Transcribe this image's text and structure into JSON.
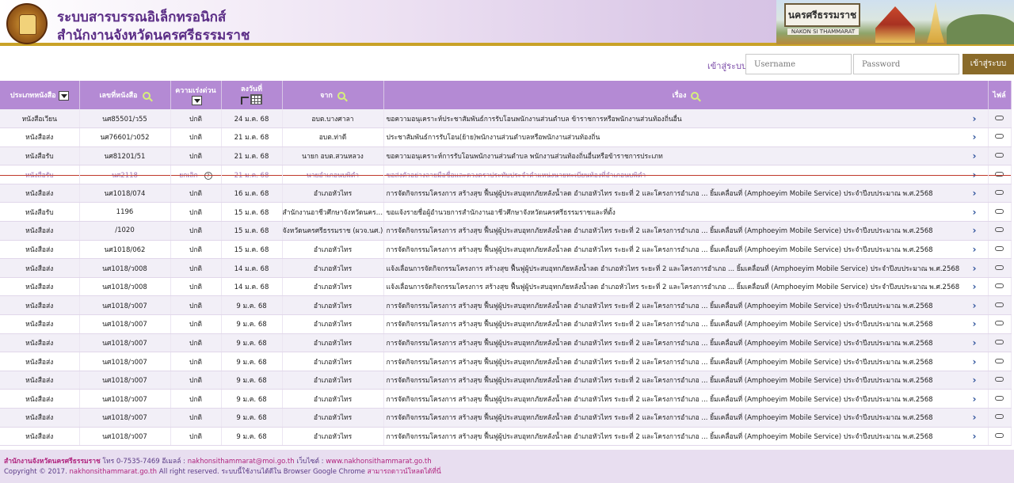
{
  "header": {
    "title_line1": "ระบบสารบรรณอิเล็กทรอนิกส์",
    "title_line2": "สำนักงานจังหวัดนครศรีธรรมราช",
    "banner_sign": "นครศรีธรรมราช",
    "banner_sign_sub": "NAKON SI THAMMARAT"
  },
  "login": {
    "label": "เข้าสู่ระบบ",
    "username_placeholder": "Username",
    "password_placeholder": "Password",
    "button": "เข้าสู่ระบบ"
  },
  "table": {
    "columns": {
      "type": "ประเภทหนังสือ",
      "number": "เลขที่หนังสือ",
      "urgency": "ความเร่งด่วน",
      "date": "ลงวันที่",
      "from": "จาก",
      "subject": "เรื่อง",
      "file": "ไฟล์"
    },
    "rows": [
      {
        "type": "หนังสือเวียน",
        "number": "นศ85501/ว55",
        "urgency": "ปกติ",
        "date": "24 ม.ค. 68",
        "from": "อบต.บางศาลา",
        "subject": "ขอความอนุเคราะห์ประชาสัมพันธ์การรับโอนพนักงานส่วนตำบล ข้าราชการหรือพนักงานส่วนท้องถิ่นอื่น"
      },
      {
        "type": "หนังสือส่ง",
        "number": "นศ76601/ว052",
        "urgency": "ปกติ",
        "date": "21 ม.ค. 68",
        "from": "อบต.ท่าดี",
        "subject": "ประชาสัมพันธ์การรับโอน(ย้าย)พนักงานส่วนตำบลหรือพนักงานส่วนท้องถิ่น"
      },
      {
        "type": "หนังสือรับ",
        "number": "นศ81201/51",
        "urgency": "ปกติ",
        "date": "21 ม.ค. 68",
        "from": "นายก อบต.สวนหลวง",
        "subject": "ขอความอนุเคราะห์การรับโอนพนักงานส่วนตำบล พนักงานส่วนท้องถิ่นอื่นหรือข้าราชการประเภท"
      },
      {
        "type": "หนังสือรับ",
        "number": "นศ2118",
        "urgency": "ยกเลิก",
        "date": "21 ม.ค. 68",
        "from": "นายอำเภอนบพิตำ",
        "subject": "ขอส่งตัวอย่างลายมือชื่อและดวงตราประทับประจำตำแหน่งนายทะเบียนท้องที่อำเภอนบพิตำ",
        "cancelled": true
      },
      {
        "type": "หนังสือส่ง",
        "number": "นศ1018/074",
        "urgency": "ปกติ",
        "date": "16 ม.ค. 68",
        "from": "อำเภอหัวไทร",
        "subject": "การจัดกิจกรรมโครงการ สร้างสุข ฟื้นฟูผู้ประสบอุทกภัยหลังน้ำลด อำเภอหัวไทร ระยะที่ 2 และโครงการอำเภอ ... ยิ้มเคลื่อนที่ (Amphoeyim Mobile Service) ประจำปีงบประมาณ พ.ศ.2568"
      },
      {
        "type": "หนังสือรับ",
        "number": "1196",
        "urgency": "ปกติ",
        "date": "15 ม.ค. 68",
        "from": "สำนักงานอาชีวศึกษาจังหวัดนครศรีธรรมราช",
        "subject": "ขอแจ้งรายชื่อผู้อำนวยการสำนักงานอาชีวศึกษาจังหวัดนครศรีธรรมราชและที่ตั้ง"
      },
      {
        "type": "หนังสือส่ง",
        "number": "/1020",
        "urgency": "ปกติ",
        "date": "15 ม.ค. 68",
        "from": "จังหวัดนครศรีธรรมราช (ผวจ.นศ.)",
        "subject": "การจัดกิจกรรมโครงการ สร้างสุข ฟื้นฟูผู้ประสบอุทกภัยหลังน้ำลด อำเภอหัวไทร ระยะที่ 2 และโครงการอำเภอ ... ยิ้มเคลื่อนที่ (Amphoeyim Mobile Service) ประจำปีงบประมาณ พ.ศ.2568"
      },
      {
        "type": "หนังสือส่ง",
        "number": "นศ1018/062",
        "urgency": "ปกติ",
        "date": "15 ม.ค. 68",
        "from": "อำเภอหัวไทร",
        "subject": "การจัดกิจกรรมโครงการ สร้างสุข ฟื้นฟูผู้ประสบอุทกภัยหลังน้ำลด อำเภอหัวไทร ระยะที่ 2 และโครงการอำเภอ ... ยิ้มเคลื่อนที่ (Amphoeyim Mobile Service) ประจำปีงบประมาณ พ.ศ.2568"
      },
      {
        "type": "หนังสือส่ง",
        "number": "นศ1018/ว008",
        "urgency": "ปกติ",
        "date": "14 ม.ค. 68",
        "from": "อำเภอหัวไทร",
        "subject": "แจ้งเลื่อนการจัดกิจกรรมโครงการ สร้างสุข ฟื้นฟูผู้ประสบอุทกภัยหลังน้ำลด อำเภอหัวไทร ระยะที่ 2 และโครงการอำเภอ ... ยิ้มเคลื่อนที่ (Amphoeyim Mobile Service) ประจำปีงบประมาณ พ.ศ.2568"
      },
      {
        "type": "หนังสือส่ง",
        "number": "นศ1018/ว008",
        "urgency": "ปกติ",
        "date": "14 ม.ค. 68",
        "from": "อำเภอหัวไทร",
        "subject": "แจ้งเลื่อนการจัดกิจกรรมโครงการ สร้างสุข ฟื้นฟูผู้ประสบอุทกภัยหลังน้ำลด อำเภอหัวไทร ระยะที่ 2 และโครงการอำเภอ ... ยิ้มเคลื่อนที่ (Amphoeyim Mobile Service) ประจำปีงบประมาณ พ.ศ.2568"
      },
      {
        "type": "หนังสือส่ง",
        "number": "นศ1018/ว007",
        "urgency": "ปกติ",
        "date": "9 ม.ค. 68",
        "from": "อำเภอหัวไทร",
        "subject": "การจัดกิจกรรมโครงการ สร้างสุข ฟื้นฟูผู้ประสบอุทกภัยหลังน้ำลด อำเภอหัวไทร ระยะที่ 2 และโครงการอำเภอ ... ยิ้มเคลื่อนที่ (Amphoeyim Mobile Service) ประจำปีงบประมาณ พ.ศ.2568"
      },
      {
        "type": "หนังสือส่ง",
        "number": "นศ1018/ว007",
        "urgency": "ปกติ",
        "date": "9 ม.ค. 68",
        "from": "อำเภอหัวไทร",
        "subject": "การจัดกิจกรรมโครงการ สร้างสุข ฟื้นฟูผู้ประสบอุทกภัยหลังน้ำลด อำเภอหัวไทร ระยะที่ 2 และโครงการอำเภอ ... ยิ้มเคลื่อนที่ (Amphoeyim Mobile Service) ประจำปีงบประมาณ พ.ศ.2568"
      },
      {
        "type": "หนังสือส่ง",
        "number": "นศ1018/ว007",
        "urgency": "ปกติ",
        "date": "9 ม.ค. 68",
        "from": "อำเภอหัวไทร",
        "subject": "การจัดกิจกรรมโครงการ สร้างสุข ฟื้นฟูผู้ประสบอุทกภัยหลังน้ำลด อำเภอหัวไทร ระยะที่ 2 และโครงการอำเภอ ... ยิ้มเคลื่อนที่ (Amphoeyim Mobile Service) ประจำปีงบประมาณ พ.ศ.2568"
      },
      {
        "type": "หนังสือส่ง",
        "number": "นศ1018/ว007",
        "urgency": "ปกติ",
        "date": "9 ม.ค. 68",
        "from": "อำเภอหัวไทร",
        "subject": "การจัดกิจกรรมโครงการ สร้างสุข ฟื้นฟูผู้ประสบอุทกภัยหลังน้ำลด อำเภอหัวไทร ระยะที่ 2 และโครงการอำเภอ ... ยิ้มเคลื่อนที่ (Amphoeyim Mobile Service) ประจำปีงบประมาณ พ.ศ.2568"
      },
      {
        "type": "หนังสือส่ง",
        "number": "นศ1018/ว007",
        "urgency": "ปกติ",
        "date": "9 ม.ค. 68",
        "from": "อำเภอหัวไทร",
        "subject": "การจัดกิจกรรมโครงการ สร้างสุข ฟื้นฟูผู้ประสบอุทกภัยหลังน้ำลด อำเภอหัวไทร ระยะที่ 2 และโครงการอำเภอ ... ยิ้มเคลื่อนที่ (Amphoeyim Mobile Service) ประจำปีงบประมาณ พ.ศ.2568"
      },
      {
        "type": "หนังสือส่ง",
        "number": "นศ1018/ว007",
        "urgency": "ปกติ",
        "date": "9 ม.ค. 68",
        "from": "อำเภอหัวไทร",
        "subject": "การจัดกิจกรรมโครงการ สร้างสุข ฟื้นฟูผู้ประสบอุทกภัยหลังน้ำลด อำเภอหัวไทร ระยะที่ 2 และโครงการอำเภอ ... ยิ้มเคลื่อนที่ (Amphoeyim Mobile Service) ประจำปีงบประมาณ พ.ศ.2568"
      },
      {
        "type": "หนังสือส่ง",
        "number": "นศ1018/ว007",
        "urgency": "ปกติ",
        "date": "9 ม.ค. 68",
        "from": "อำเภอหัวไทร",
        "subject": "การจัดกิจกรรมโครงการ สร้างสุข ฟื้นฟูผู้ประสบอุทกภัยหลังน้ำลด อำเภอหัวไทร ระยะที่ 2 และโครงการอำเภอ ... ยิ้มเคลื่อนที่ (Amphoeyim Mobile Service) ประจำปีงบประมาณ พ.ศ.2568"
      },
      {
        "type": "หนังสือส่ง",
        "number": "นศ1018/ว007",
        "urgency": "ปกติ",
        "date": "9 ม.ค. 68",
        "from": "อำเภอหัวไทร",
        "subject": "การจัดกิจกรรมโครงการ สร้างสุข ฟื้นฟูผู้ประสบอุทกภัยหลังน้ำลด อำเภอหัวไทร ระยะที่ 2 และโครงการอำเภอ ... ยิ้มเคลื่อนที่ (Amphoeyim Mobile Service) ประจำปีงบประมาณ พ.ศ.2568"
      }
    ]
  },
  "footer": {
    "org": "สำนักงานจังหวัดนครศรีธรรมราช",
    "contact": " โทร 0-7535-7469 อีเมลล์ : ",
    "email": "nakhonsithammarat@moi.go.th",
    "web_label": " เว็บไซต์ : ",
    "website": "www.nakhonsithammarat.go.th",
    "copyright_prefix": "Copyright © 2017. ",
    "copyright_site": "nakhonsithammarat.go.th",
    "copyright_suffix": " All right reserved. ระบบนี้ใช้งานได้ดีใน Browser Google Chrome ",
    "download_text": "สามารถดาวน์โหลดได้ที่นี่"
  }
}
